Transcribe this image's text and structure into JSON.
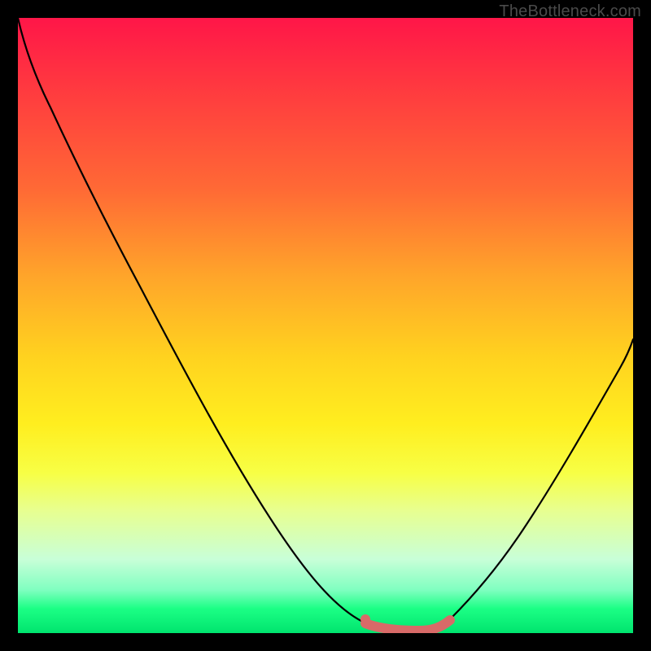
{
  "attrib": "TheBottleneck.com",
  "chart_data": {
    "type": "line",
    "title": "",
    "xlabel": "",
    "ylabel": "",
    "xlim": [
      0,
      100
    ],
    "ylim": [
      0,
      100
    ],
    "series": [
      {
        "name": "bottleneck-curve",
        "x": [
          0,
          5,
          10,
          15,
          20,
          25,
          30,
          35,
          40,
          45,
          50,
          55,
          58,
          60,
          63,
          66,
          68,
          70,
          73,
          76,
          80,
          85,
          90,
          95,
          100
        ],
        "values": [
          100,
          92,
          84,
          76,
          68,
          60,
          52,
          44,
          36,
          27,
          18,
          9,
          3,
          1.2,
          0.5,
          0.5,
          0.8,
          1.5,
          4,
          8,
          15,
          24,
          33,
          42,
          51
        ]
      },
      {
        "name": "highlight-band",
        "x": [
          58,
          60,
          63,
          66,
          68,
          70
        ],
        "values": [
          3,
          1.2,
          0.5,
          0.5,
          0.8,
          1.5
        ]
      }
    ]
  }
}
